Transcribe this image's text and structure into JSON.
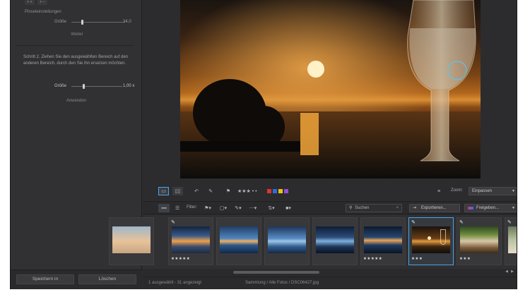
{
  "left_panel": {
    "step_buttons": [
      "+ +",
      "+ −"
    ],
    "brush_settings_label": "Pinseleinstellungen",
    "size_label_1": "Größe",
    "size_value_1": "34,0",
    "next_button": "Weiter",
    "step2_text": "Schritt 2. Ziehen Sie den ausgewählten Bereich auf den anderen Bereich, durch den Sie ihn ersetzen möchten.",
    "size_label_2": "Größe",
    "size_value_2": "1,00 x",
    "apply_button": "Anwenden",
    "save_in_button": "Speichern in",
    "delete_button": "Löschen"
  },
  "toolbar": {
    "rating_stars": "★★★ • •",
    "color_labels": [
      "#e2322e",
      "#2f6ce0",
      "#e8c21c",
      "#8f4fd6"
    ],
    "zoom_label": "Zoom:",
    "zoom_value": "Einpassen",
    "filter_label": "Filter:",
    "search_placeholder": "Suchen",
    "export_button": "Exportieren...",
    "share_button": "Freigeben..."
  },
  "filmstrip": {
    "items": [
      {
        "stars": "",
        "pen": false
      },
      {
        "stars": "★★★★★",
        "pen": true
      },
      {
        "stars": "",
        "pen": false
      },
      {
        "stars": "",
        "pen": false
      },
      {
        "stars": "",
        "pen": false
      },
      {
        "stars": "★★★★★",
        "pen": false
      },
      {
        "stars": "★★★",
        "pen": true,
        "selected": true
      },
      {
        "stars": "★★★",
        "pen": true
      },
      {
        "stars": "",
        "pen": true
      }
    ]
  },
  "status": {
    "selection": "1 ausgewählt - 31 angezeigt",
    "path": "Sammlung / Alle Fotos / DSC06427.jpg"
  },
  "colors": {
    "accent": "#4aa3ea",
    "panel": "#313133"
  }
}
